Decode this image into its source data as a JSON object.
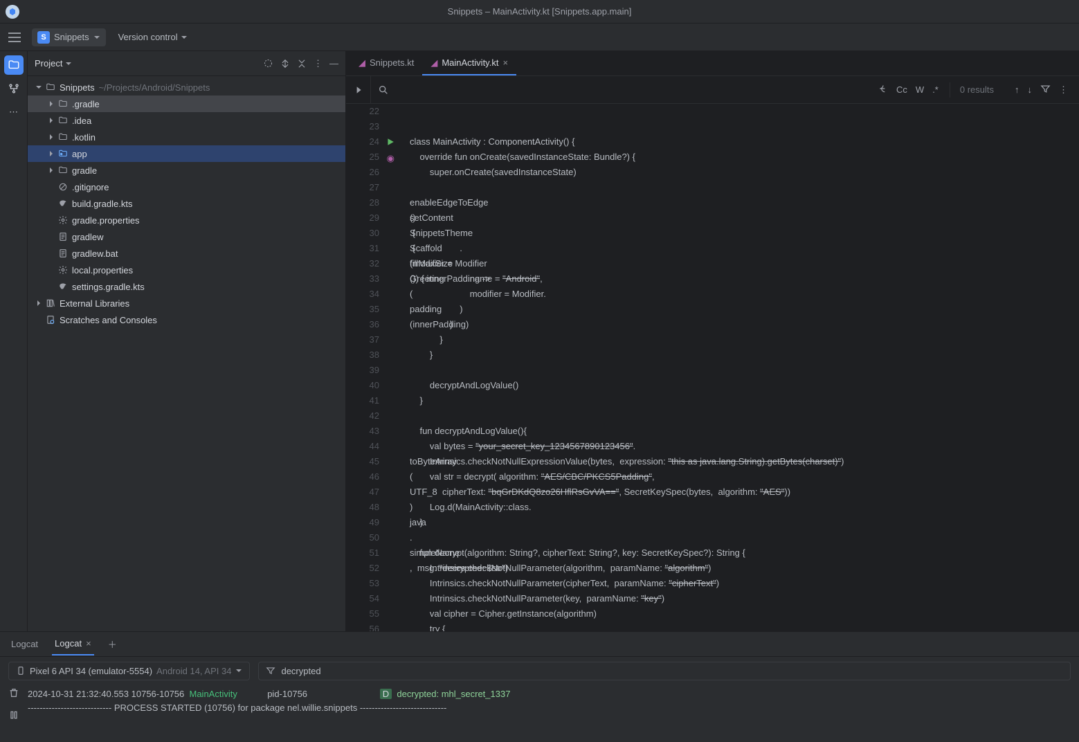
{
  "title": "Snippets – MainActivity.kt [Snippets.app.main]",
  "nav": {
    "project": "Snippets",
    "projectInitial": "S",
    "vcs": "Version control"
  },
  "panel": {
    "title": "Project"
  },
  "tree": {
    "root": {
      "name": "Snippets",
      "hint": "~/Projects/Android/Snippets"
    },
    "items": [
      {
        "name": ".gradle",
        "icon": "folder",
        "depth": 1,
        "arrow": ">",
        "hl": true
      },
      {
        "name": ".idea",
        "icon": "folder",
        "depth": 1,
        "arrow": ">"
      },
      {
        "name": ".kotlin",
        "icon": "folder",
        "depth": 1,
        "arrow": ">"
      },
      {
        "name": "app",
        "icon": "module",
        "depth": 1,
        "arrow": ">",
        "sel": true
      },
      {
        "name": "gradle",
        "icon": "folder",
        "depth": 1,
        "arrow": ">"
      },
      {
        "name": ".gitignore",
        "icon": "ignore",
        "depth": 1
      },
      {
        "name": "build.gradle.kts",
        "icon": "gradle",
        "depth": 1
      },
      {
        "name": "gradle.properties",
        "icon": "gear",
        "depth": 1
      },
      {
        "name": "gradlew",
        "icon": "text",
        "depth": 1
      },
      {
        "name": "gradlew.bat",
        "icon": "text",
        "depth": 1
      },
      {
        "name": "local.properties",
        "icon": "gear",
        "depth": 1
      },
      {
        "name": "settings.gradle.kts",
        "icon": "gradle",
        "depth": 1
      }
    ],
    "ext": {
      "name": "External Libraries"
    },
    "scratch": {
      "name": "Scratches and Consoles"
    }
  },
  "tabs": [
    {
      "name": "Snippets.kt"
    },
    {
      "name": "MainActivity.kt",
      "active": true
    }
  ],
  "find": {
    "results": "0 results",
    "cc": "Cc",
    "w": "W",
    "re": ".*"
  },
  "code": {
    "start": 22,
    "lines": [
      "",
      "",
      "<k>class</k> <c>MainActivity</c> : <c>ComponentActivity</c>() <c>{</c><cur></cur>",
      "    <k>override</k> <k>fun</k> <fn>onCreate</fn>(savedInstanceState: Bundle?) {",
      "        <k>super</k>.onCreate(savedInstanceState)",
      "        <p>enableEdgeToEdge</p>()",
      "        <p>setContent</p> <k>{</k>",
      "            <p>SnippetsTheme</p> <k>{</k>",
      "                <p>Scaffold</p>(<fn>modifier</fn> = Modifier",
      "                    .<p>fillMaxSize</p>()) { innerPadding <k>-></k>",
      "                    <p>Greeting</p>(",
      "                        <fn>name</fn> = <s>\"Android\"</s>,",
      "                        <fn>modifier</fn> = Modifier.<p>padding</p>(innerPadding)",
      "                    )",
      "                <k>}</k>",
      "            <k>}</k>",
      "        <k>}</k>",
      "",
      "        decryptAndLogValue()",
      "    }",
      "",
      "    <k>fun</k> <fn><ud>decryptAndLogValue</ud></fn>(){",
      "        <k>val</k> <c>bytes</c> = <s>\"your_secret_key_1234567890123456\"</s>.<p>toByteArray</p>(<p>UTF_8</p>)",
      "        Intrinsics.checkNotNullExpressionValue(bytes,  <an>expression:</an> <s>\"this as java.lang.String).getBytes(charset)\"</s>)",
      "        <k>val</k> <c>str</c> = decrypt( <an>algorithm:</an> <s>\"AES/CBC/PKCS5Padding\"</s>,",
      "             <an>cipherText:</an> <s>\"bqGrDKdQ8zo26HflRsGvVA==\"</s>, SecretKeySpec(bytes,  <an>algorithm:</an> <s>\"AES\"</s>))",
      "        Log.d(MainActivity::<k>class</k>.<p>java</p>.<p>simpleName</p>,  <an>msg:</an> <s>\"decrypted: </s><c>$</c><c>str</c><s>\"</s>)",
      "    }",
      "",
      "    <k>fun</k> <fn><ud>decrypt</ud></fn>(algorithm: String?, cipherText: String?, key: SecretKeySpec?): String {",
      "        Intrinsics.checkNotNullParameter(algorithm,  <an>paramName:</an> <s>\"algorithm\"</s>)",
      "        Intrinsics.checkNotNullParameter(cipherText,  <an>paramName:</an> <s>\"cipherText\"</s>)",
      "        Intrinsics.checkNotNullParameter(key,  <an>paramName:</an> <s>\"key\"</s>)",
      "        <k>val</k> <c>cipher</c> = Cipher.getInstance(algorithm)",
      "        <k>try</k> {"
    ]
  },
  "logcat": {
    "tab1": "Logcat",
    "tab2": "Logcat",
    "device": "Pixel 6 API 34 (emulator-5554)",
    "deviceHint": "Android 14, API 34",
    "filter": "decrypted",
    "ts": "2024-10-31 21:32:40.553 10756-10756",
    "tag": "MainActivity",
    "pid": "pid-10756",
    "level": "D",
    "msg": "decrypted: mhl_secret_1337",
    "proc": "---------------------------- PROCESS STARTED (10756) for package nel.willie.snippets -----------------------------"
  }
}
